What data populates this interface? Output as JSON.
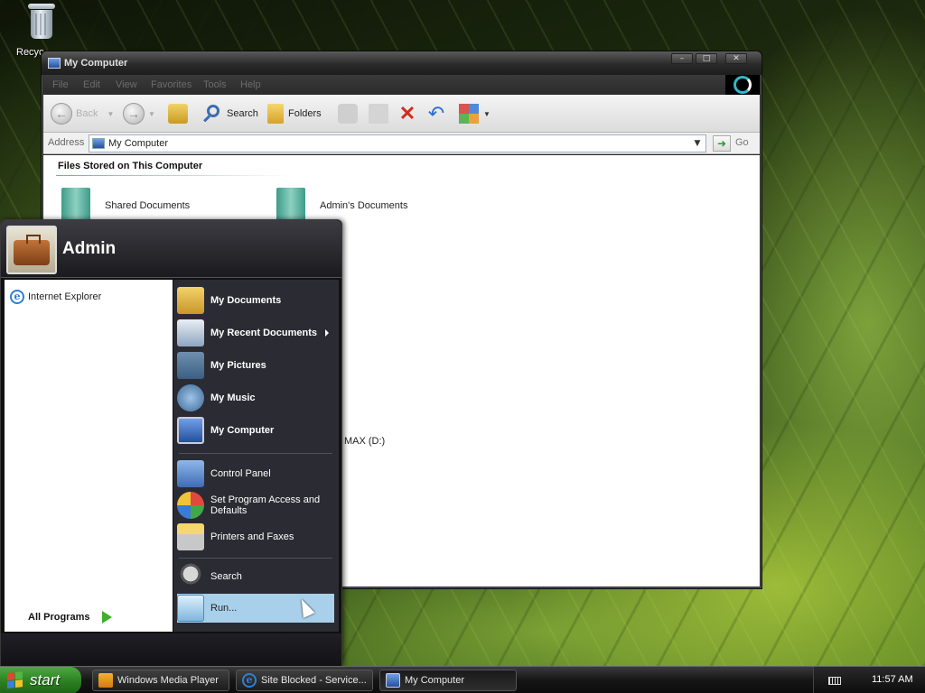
{
  "desktop": {
    "icons": [
      {
        "label": "Recycle Bin",
        "icon": "recycle-bin-icon"
      }
    ]
  },
  "window": {
    "title": "My Computer",
    "menu": [
      "File",
      "Edit",
      "View",
      "Favorites",
      "Tools",
      "Help"
    ],
    "toolbar": {
      "back": "Back",
      "search": "Search",
      "folders": "Folders"
    },
    "address": {
      "label": "Address",
      "value": "My Computer",
      "go": "Go"
    },
    "section_title": "Files Stored on This Computer",
    "items": [
      "Shared Documents",
      "Admin's Documents"
    ],
    "drive_label": "MAX (D:)"
  },
  "start_menu": {
    "user": "Admin",
    "pinned": [
      {
        "label": "Internet Explorer",
        "icon": "internet-explorer-icon"
      }
    ],
    "all_programs": "All Programs",
    "places": [
      {
        "label": "My Documents",
        "icon": "my-documents-icon"
      },
      {
        "label": "My Recent Documents",
        "icon": "recent-documents-icon"
      },
      {
        "label": "My Pictures",
        "icon": "my-pictures-icon"
      },
      {
        "label": "My Music",
        "icon": "my-music-icon"
      },
      {
        "label": "My Computer",
        "icon": "my-computer-icon"
      }
    ],
    "settings": [
      {
        "label": "Control Panel",
        "icon": "control-panel-icon"
      },
      {
        "label": "Set Program Access and Defaults",
        "icon": "program-access-icon"
      },
      {
        "label": "Printers and Faxes",
        "icon": "printers-icon"
      }
    ],
    "search": "Search",
    "run": "Run..."
  },
  "taskbar": {
    "start": "start",
    "tasks": [
      "Windows Media Player",
      "Site Blocked - Service...",
      "My Computer"
    ],
    "clock": "11:57 AM"
  },
  "colors": {
    "accent": "#2c7f22",
    "start_menu_right": "#2b2b33",
    "highlight": "#a9d0ea"
  }
}
